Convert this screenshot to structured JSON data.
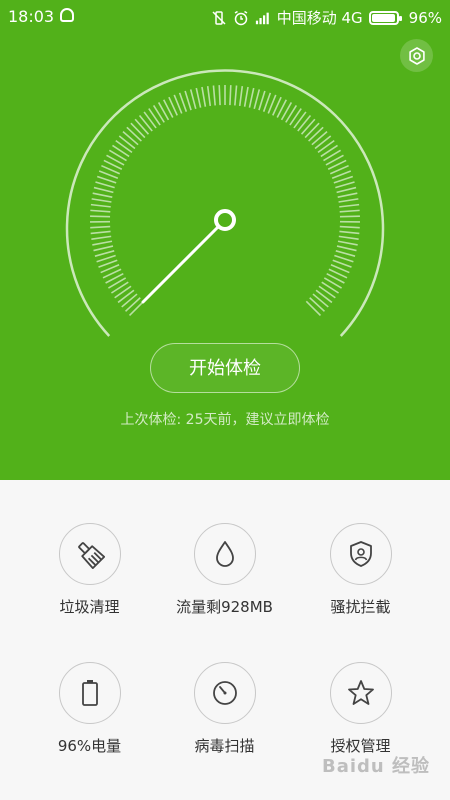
{
  "status_bar": {
    "time": "18:03",
    "carrier": "中国移动 4G",
    "battery": "96%",
    "battery_level": 0.96
  },
  "colors": {
    "header_green": "#52b11a",
    "text_dark": "#333333",
    "outline_gray": "#c8c8c8"
  },
  "header": {
    "check_button": "开始体检",
    "last_check_text": "上次体检: 25天前，建议立即体检"
  },
  "tools": [
    {
      "label": "垃圾清理",
      "icon": "broom-icon"
    },
    {
      "label": "流量剩928MB",
      "icon": "water-drop-icon"
    },
    {
      "label": "骚扰拦截",
      "icon": "shield-user-icon"
    },
    {
      "label": "96%电量",
      "icon": "battery-icon"
    },
    {
      "label": "病毒扫描",
      "icon": "scan-dial-icon"
    },
    {
      "label": "授权管理",
      "icon": "star-icon"
    }
  ],
  "watermark": "Baidu 经验"
}
